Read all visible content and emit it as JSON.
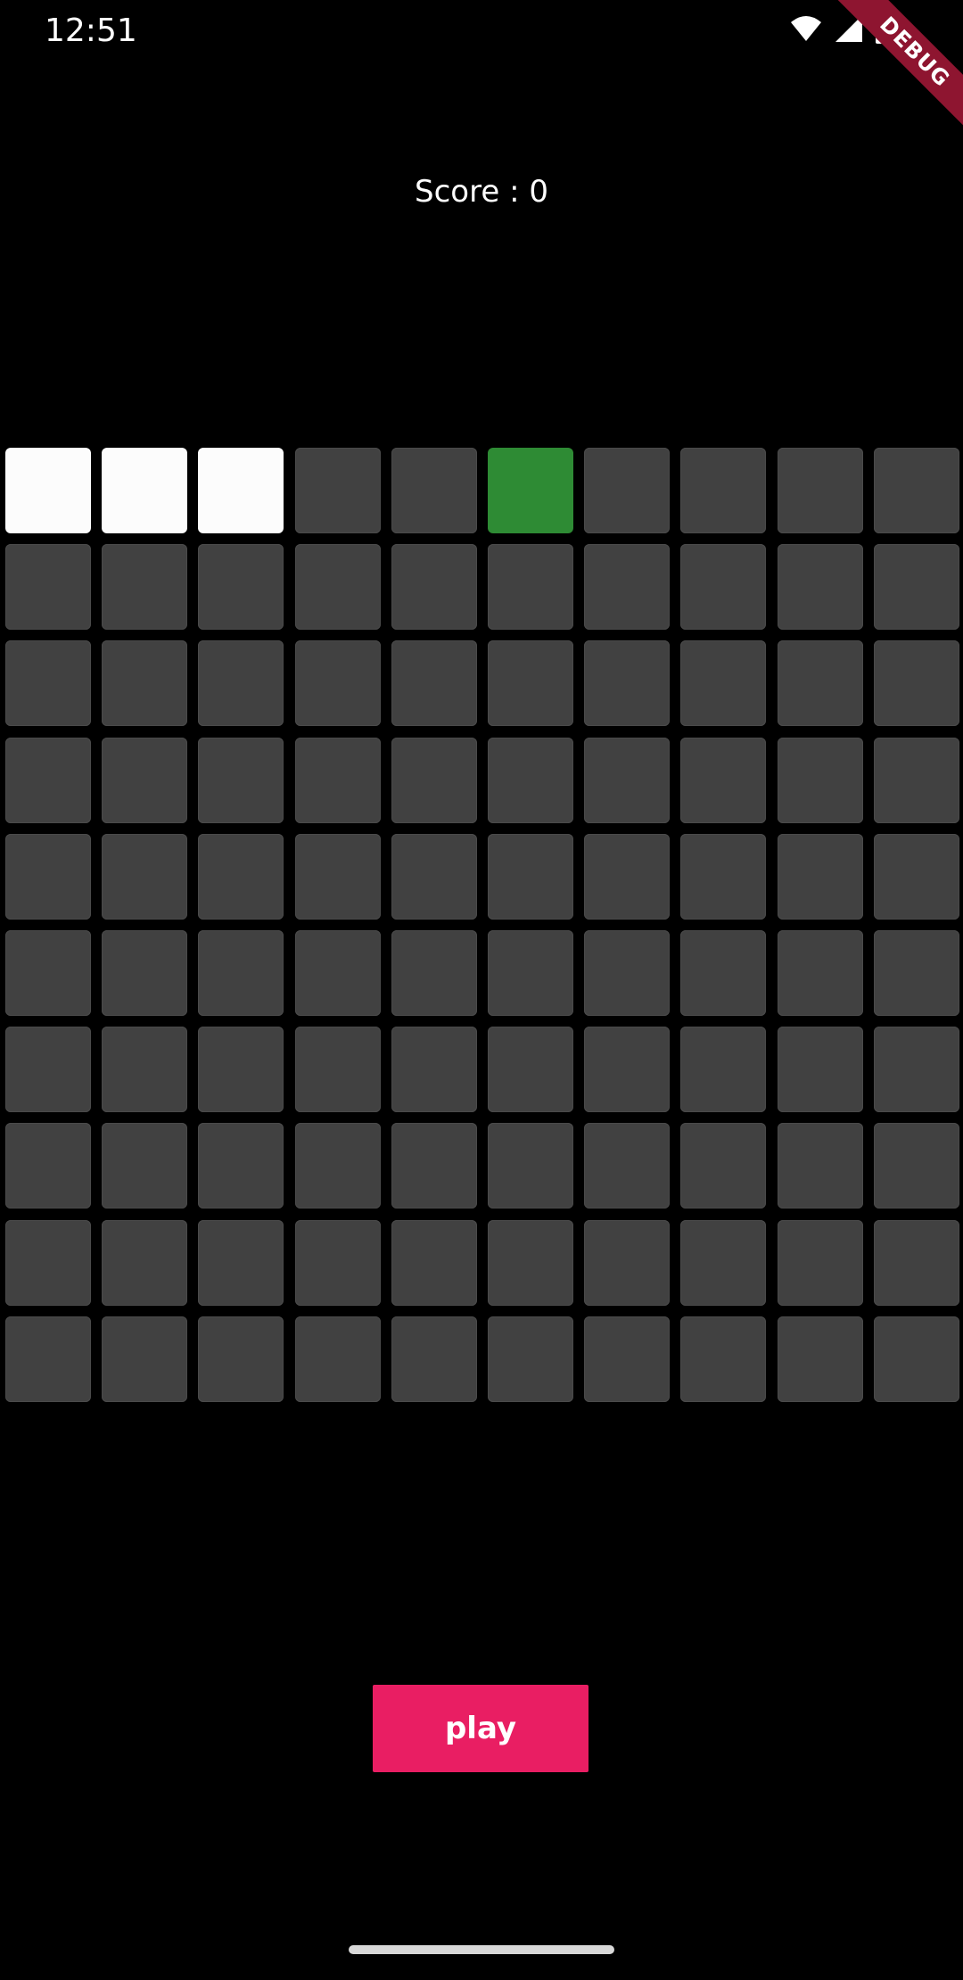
{
  "status_bar": {
    "time": "12:51",
    "icons": [
      "wifi-icon",
      "signal-icon",
      "battery-icon"
    ]
  },
  "debug_banner": {
    "label": "DEBUG",
    "color": "#8e1530"
  },
  "score": {
    "text": "Score : 0"
  },
  "board": {
    "rows": 10,
    "cols": 10,
    "empty_color": "#414141",
    "snake_color": "#fcfcfc",
    "food_color": "#2e8b34",
    "snake_cells": [
      [
        0,
        0
      ],
      [
        0,
        1
      ],
      [
        0,
        2
      ]
    ],
    "food_cell": [
      0,
      5
    ]
  },
  "play_button": {
    "label": "play",
    "color": "#e91e63"
  }
}
